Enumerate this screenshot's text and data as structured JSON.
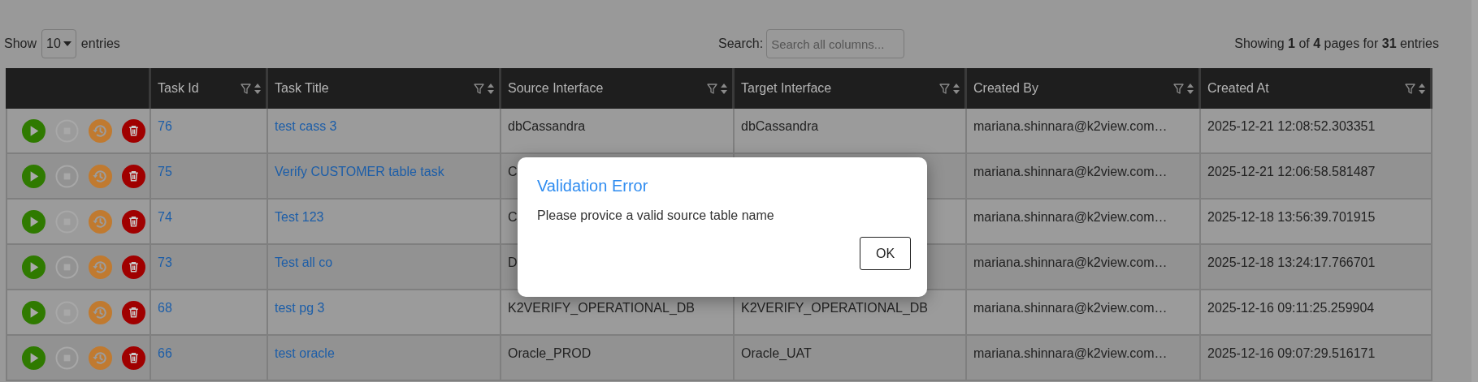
{
  "length_menu": {
    "label_before": "Show",
    "value": "10",
    "label_after": "entries"
  },
  "search": {
    "label": "Search:",
    "placeholder": "Search all columns..."
  },
  "info": "Showing **1** of **4** pages for **31** entries",
  "table": {
    "columns": [
      "Task Id",
      "Task Title",
      "Source Interface",
      "Target Interface",
      "Created By",
      "Created At"
    ],
    "rows": [
      {
        "task_id": "76",
        "task_title": "test cass 3",
        "source_interface": "dbCassandra",
        "target_interface": "dbCassandra",
        "created_by": "mariana.shinnara@k2view.com…",
        "created_at": "2025-12-21 12:08:52.303351",
        "stop_disabled": true
      },
      {
        "task_id": "75",
        "task_title": "Verify CUSTOMER table task",
        "source_interface": "C",
        "created_by": "mariana.shinnara@k2view.com…",
        "created_at": "2025-12-21 12:06:58.581487",
        "stop_disabled": true
      },
      {
        "task_id": "74",
        "task_title": "Test 123",
        "source_interface": "C",
        "created_by": "mariana.shinnara@k2view.com…",
        "created_at": "2025-12-18 13:56:39.701915",
        "stop_disabled": true
      },
      {
        "task_id": "73",
        "task_title": "Test all co",
        "source_interface": "D",
        "created_by": "mariana.shinnara@k2view.com…",
        "created_at": "2025-12-18 13:24:17.766701",
        "stop_disabled": true
      },
      {
        "task_id": "68",
        "task_title": "test pg 3",
        "source_interface": "K2VERIFY_OPERATIONAL_DB",
        "target_interface": "K2VERIFY_OPERATIONAL_DB",
        "created_by": "mariana.shinnara@k2view.com…",
        "created_at": "2025-12-16 09:11:25.259904",
        "stop_disabled": true
      },
      {
        "task_id": "66",
        "task_title": "test oracle",
        "source_interface": "Oracle_PROD",
        "target_interface": "Oracle_UAT",
        "created_by": "mariana.shinnara@k2view.com…",
        "created_at": "2025-12-16 09:07:29.516171",
        "stop_disabled": true
      }
    ]
  },
  "dialog": {
    "title": "Validation Error",
    "message": "Please provice a valid source table name",
    "button": "OK"
  }
}
